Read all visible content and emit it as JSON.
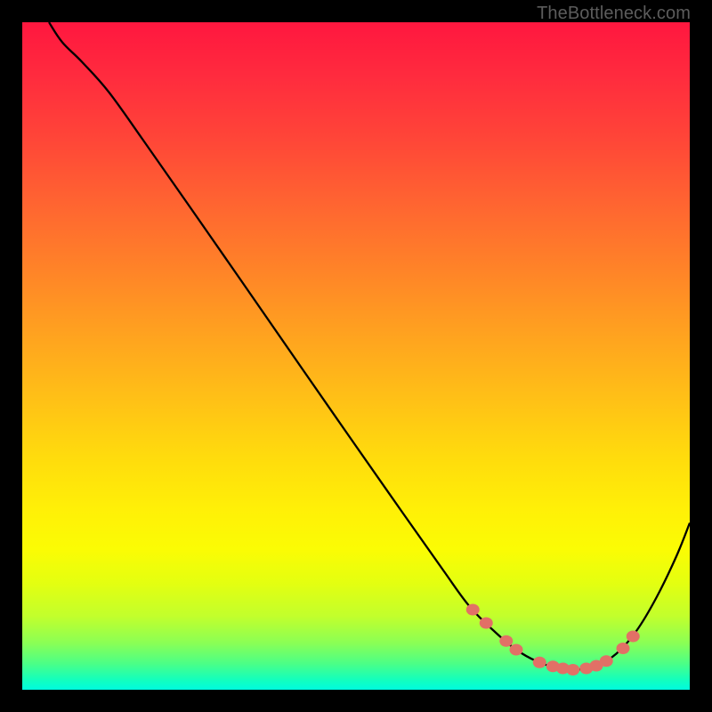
{
  "watermark": "TheBottleneck.com",
  "chart_data": {
    "type": "line",
    "title": "",
    "xlabel": "",
    "ylabel": "",
    "xlim": [
      0,
      100
    ],
    "ylim": [
      0,
      100
    ],
    "curve": [
      {
        "x": 4,
        "y": 100
      },
      {
        "x": 6,
        "y": 97
      },
      {
        "x": 9,
        "y": 94
      },
      {
        "x": 13,
        "y": 89.5
      },
      {
        "x": 18,
        "y": 82.5
      },
      {
        "x": 25,
        "y": 72.5
      },
      {
        "x": 33,
        "y": 61
      },
      {
        "x": 42,
        "y": 48
      },
      {
        "x": 50,
        "y": 36.5
      },
      {
        "x": 57,
        "y": 26.5
      },
      {
        "x": 63,
        "y": 18
      },
      {
        "x": 67,
        "y": 12.5
      },
      {
        "x": 71,
        "y": 8.5
      },
      {
        "x": 74,
        "y": 6
      },
      {
        "x": 77,
        "y": 4.3
      },
      {
        "x": 80,
        "y": 3.3
      },
      {
        "x": 83,
        "y": 3
      },
      {
        "x": 86,
        "y": 3.6
      },
      {
        "x": 89,
        "y": 5.4
      },
      {
        "x": 92,
        "y": 8.8
      },
      {
        "x": 95,
        "y": 13.8
      },
      {
        "x": 98,
        "y": 20
      },
      {
        "x": 100,
        "y": 25
      }
    ],
    "markers": [
      {
        "x": 67.5,
        "y": 12.0
      },
      {
        "x": 69.5,
        "y": 10.0
      },
      {
        "x": 72.5,
        "y": 7.3
      },
      {
        "x": 74.0,
        "y": 6.0
      },
      {
        "x": 77.5,
        "y": 4.1
      },
      {
        "x": 79.5,
        "y": 3.5
      },
      {
        "x": 81.0,
        "y": 3.2
      },
      {
        "x": 82.5,
        "y": 3.0
      },
      {
        "x": 84.5,
        "y": 3.2
      },
      {
        "x": 86.0,
        "y": 3.6
      },
      {
        "x": 87.5,
        "y": 4.3
      },
      {
        "x": 90.0,
        "y": 6.2
      },
      {
        "x": 91.5,
        "y": 8.0
      }
    ],
    "gradient_colors": {
      "top": "#ff173f",
      "mid_upper": "#ff8328",
      "mid": "#fff007",
      "mid_lower": "#8aff55",
      "bottom": "#00fbde"
    }
  }
}
